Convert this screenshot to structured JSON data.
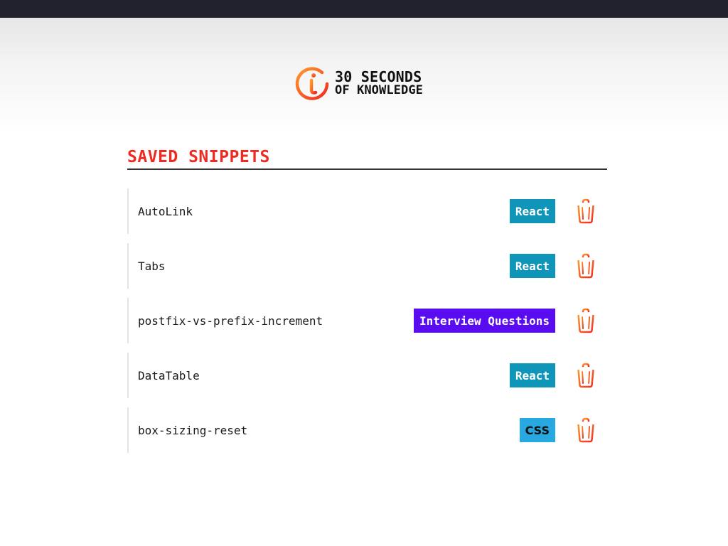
{
  "logo": {
    "line1": "30 SECONDS",
    "line2": "OF KNOWLEDGE",
    "icon": "info-circle-logo-icon"
  },
  "page": {
    "title": "SAVED SNIPPETS"
  },
  "colors": {
    "title": "#ef2a22",
    "react_tag": "#0e95b8",
    "interview_tag": "#5a0cf0",
    "css_tag": "#27a8e0",
    "trash_gradient_start": "#ff9a2a",
    "trash_gradient_end": "#ef2a22"
  },
  "snippets": [
    {
      "name": "AutoLink",
      "tag": "React",
      "tag_color": "#0e95b8",
      "tag_text_dark": false,
      "delete_icon": "trash-icon"
    },
    {
      "name": "Tabs",
      "tag": "React",
      "tag_color": "#0e95b8",
      "tag_text_dark": false,
      "delete_icon": "trash-icon"
    },
    {
      "name": "postfix-vs-prefix-increment",
      "tag": "Interview Questions",
      "tag_color": "#5a0cf0",
      "tag_text_dark": false,
      "delete_icon": "trash-icon"
    },
    {
      "name": "DataTable",
      "tag": "React",
      "tag_color": "#0e95b8",
      "tag_text_dark": false,
      "delete_icon": "trash-icon"
    },
    {
      "name": "box-sizing-reset",
      "tag": "CSS",
      "tag_color": "#27a8e0",
      "tag_text_dark": true,
      "delete_icon": "trash-icon"
    }
  ]
}
